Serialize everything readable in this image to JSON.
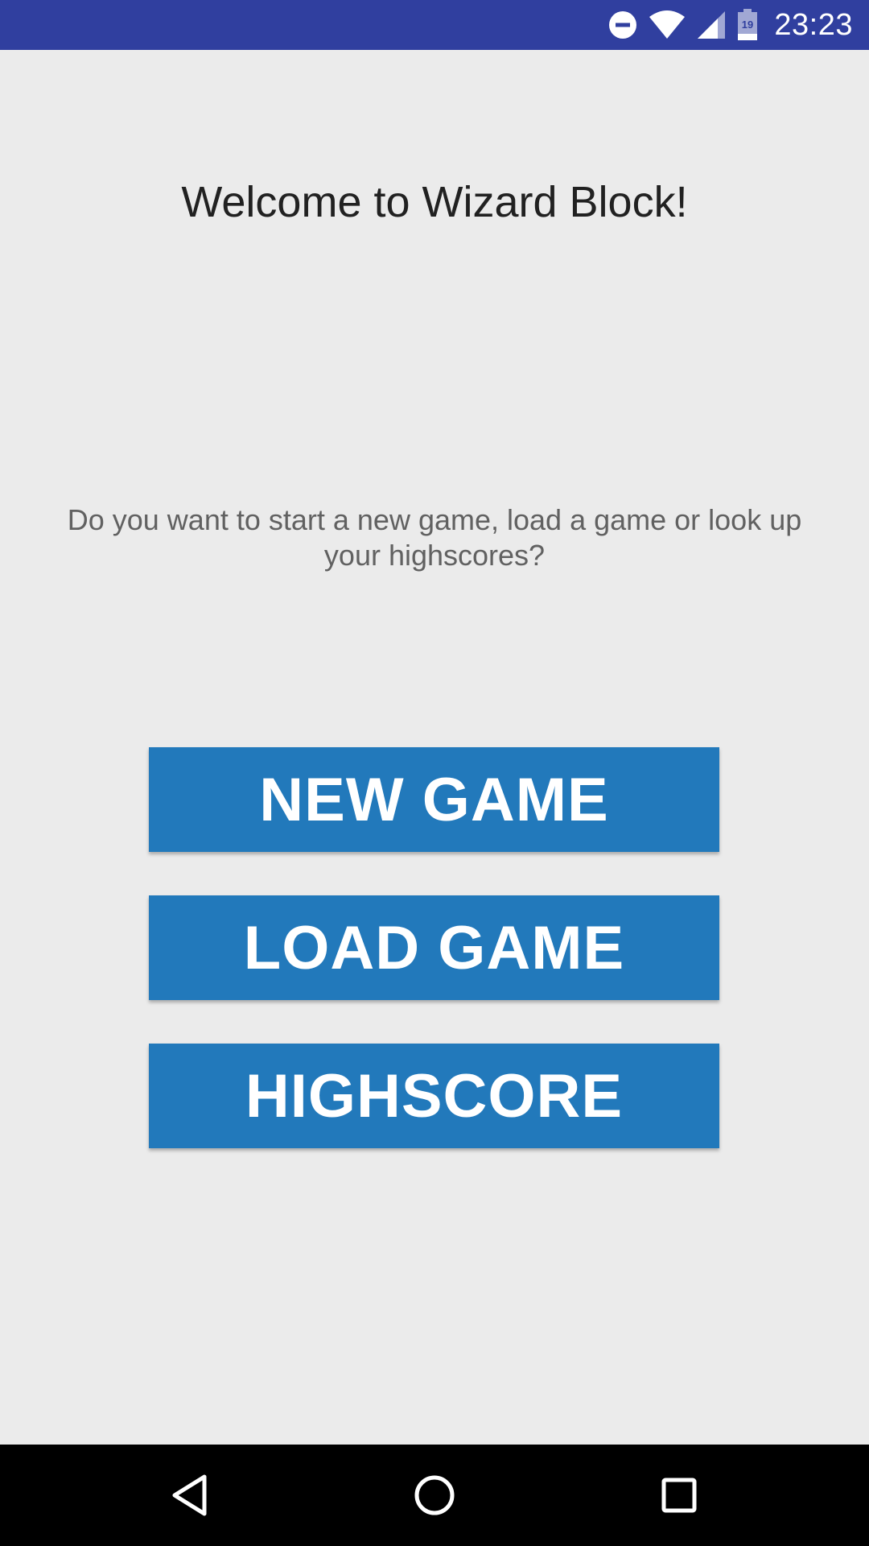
{
  "status_bar": {
    "time": "23:23",
    "battery_level": "19",
    "icons": [
      "do-not-disturb-icon",
      "wifi-icon",
      "cell-signal-icon",
      "battery-icon"
    ]
  },
  "main": {
    "title": "Welcome to Wizard Block!",
    "prompt": "Do you want to start a new game, load a game or look up your highscores?",
    "buttons": {
      "new_game": "NEW GAME",
      "load_game": "LOAD GAME",
      "highscore": "HIGHSCORE"
    }
  },
  "nav_bar": {
    "icons": [
      "back-icon",
      "home-icon",
      "recents-icon"
    ]
  },
  "colors": {
    "status_bar": "#303f9f",
    "background": "#ebebeb",
    "button": "#2279bb",
    "nav_bar": "#000000"
  }
}
